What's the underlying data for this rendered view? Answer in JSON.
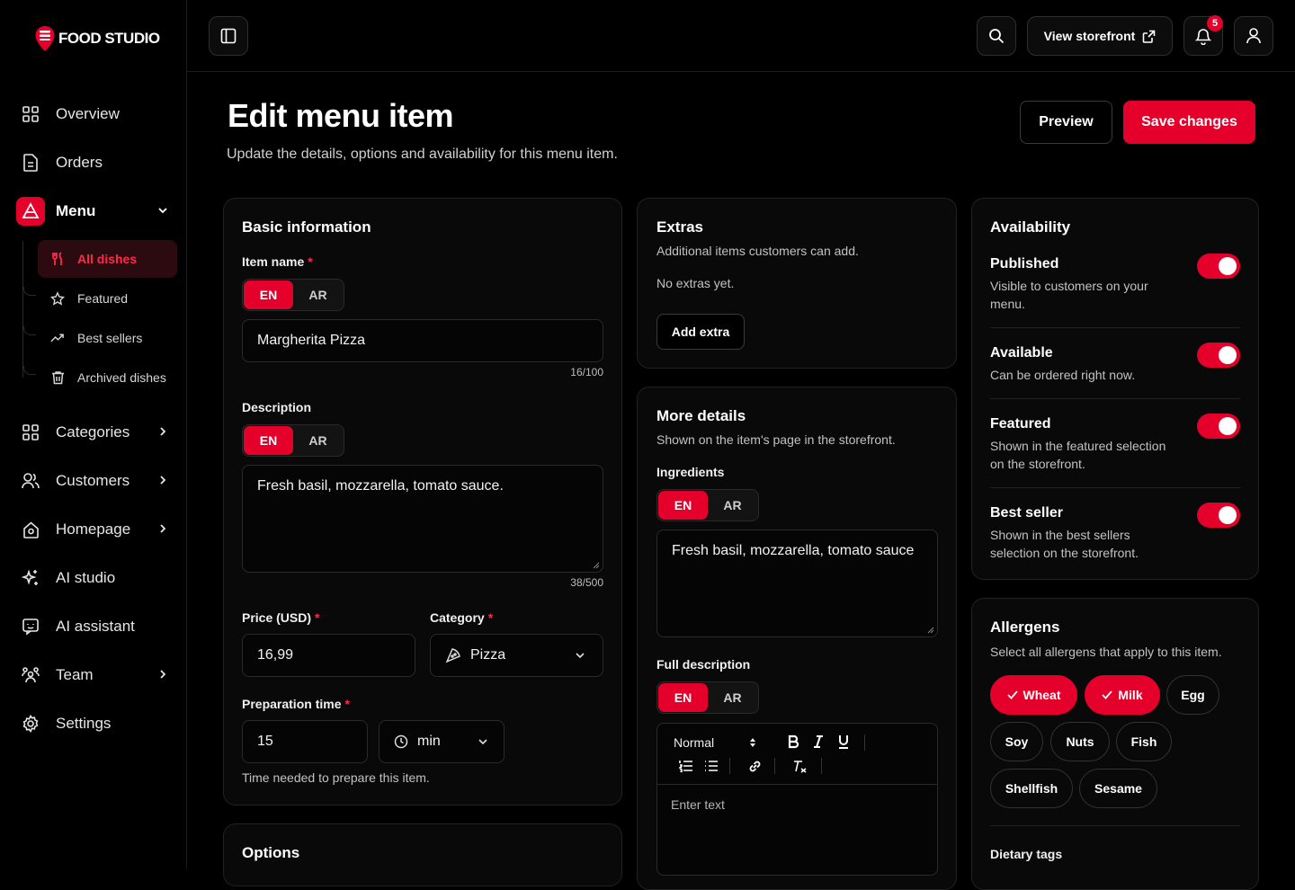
{
  "brand": {
    "name": "FOOD STUDIO"
  },
  "sidebar": {
    "items": [
      {
        "label": "Overview",
        "icon": "grid-icon"
      },
      {
        "label": "Orders",
        "icon": "document-icon"
      },
      {
        "label": "Menu",
        "icon": "menu-icon"
      },
      {
        "label": "Categories",
        "icon": "grid-icon"
      },
      {
        "label": "Customers",
        "icon": "users-icon"
      },
      {
        "label": "Homepage",
        "icon": "home-icon"
      },
      {
        "label": "AI studio",
        "icon": "sparkles-icon"
      },
      {
        "label": "AI assistant",
        "icon": "chat-bot-icon"
      },
      {
        "label": "Team",
        "icon": "team-icon"
      },
      {
        "label": "Settings",
        "icon": "gear-icon"
      }
    ],
    "menu_sub": [
      {
        "label": "All dishes"
      },
      {
        "label": "Featured"
      },
      {
        "label": "Best sellers"
      },
      {
        "label": "Archived dishes"
      }
    ]
  },
  "topbar": {
    "storefront_label": "View storefront",
    "notifications_count": "5"
  },
  "page": {
    "title": "Edit menu item",
    "subtitle": "Update the details, options and availability for this menu item.",
    "preview_label": "Preview",
    "save_label": "Save changes"
  },
  "lang": {
    "en": "EN",
    "ar": "AR"
  },
  "basic": {
    "title": "Basic information",
    "item_name_label": "Item name",
    "item_name_value": "Margherita Pizza",
    "item_name_counter": "16/100",
    "description_label": "Description",
    "description_value": "Fresh basil, mozzarella, tomato sauce.",
    "description_counter": "38/500",
    "price_label": "Price (USD)",
    "price_value": "16,99",
    "category_label": "Category",
    "category_value": "Pizza",
    "prep_label": "Preparation time",
    "prep_value": "15",
    "prep_unit": "min",
    "prep_hint": "Time needed to prepare this item.",
    "required_mark": "*"
  },
  "options": {
    "title": "Options"
  },
  "extras": {
    "title": "Extras",
    "subtitle": "Additional items customers can add.",
    "empty": "No extras yet.",
    "add_label": "Add extra"
  },
  "more": {
    "title": "More details",
    "subtitle": "Shown on the item's page in the storefront.",
    "ingredients_label": "Ingredients",
    "ingredients_value": "Fresh basil, mozzarella, tomato sauce",
    "full_desc_label": "Full description",
    "editor_format": "Normal",
    "editor_placeholder": "Enter text"
  },
  "availability": {
    "title": "Availability",
    "items": [
      {
        "title": "Published",
        "desc1": "Visible to customers on your",
        "desc2": "menu.",
        "on": true
      },
      {
        "title": "Available",
        "desc1": "Can be ordered right now.",
        "desc2": "",
        "on": true
      },
      {
        "title": "Featured",
        "desc1": "Shown in the featured selection",
        "desc2": "on the storefront.",
        "on": true
      },
      {
        "title": "Best seller",
        "desc1": "Shown in the best sellers",
        "desc2": "selection on the storefront.",
        "on": true
      }
    ]
  },
  "allergens": {
    "title": "Allergens",
    "subtitle": "Select all allergens that apply to this item.",
    "chips": [
      {
        "label": "Wheat",
        "selected": true
      },
      {
        "label": "Milk",
        "selected": true
      },
      {
        "label": "Egg",
        "selected": false
      },
      {
        "label": "Soy",
        "selected": false
      },
      {
        "label": "Nuts",
        "selected": false
      },
      {
        "label": "Fish",
        "selected": false
      },
      {
        "label": "Shellfish",
        "selected": false
      },
      {
        "label": "Sesame",
        "selected": false
      }
    ],
    "dietary_label": "Dietary tags"
  },
  "colors": {
    "accent": "#e4002b",
    "background": "#000000",
    "card": "#090909",
    "border": "#222222"
  }
}
